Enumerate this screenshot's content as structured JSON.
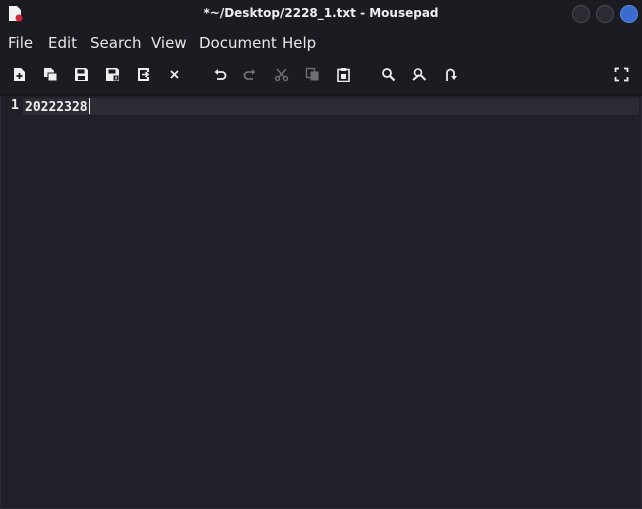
{
  "window": {
    "title": "*~/Desktop/2228_1.txt - Mousepad",
    "app_icon": "mousepad-app-icon"
  },
  "menubar": {
    "items": [
      "File",
      "Edit",
      "Search",
      "View",
      "Document",
      "Help"
    ]
  },
  "toolbar": {
    "buttons": [
      {
        "icon": "new-document-icon",
        "enabled": true
      },
      {
        "icon": "new-window-icon",
        "enabled": true
      },
      {
        "icon": "save-icon",
        "enabled": true
      },
      {
        "icon": "save-as-icon",
        "enabled": true
      },
      {
        "icon": "reload-icon",
        "enabled": true
      },
      {
        "icon": "close-tab-icon",
        "enabled": true
      },
      {
        "icon": "undo-icon",
        "enabled": true
      },
      {
        "icon": "redo-icon",
        "enabled": false
      },
      {
        "icon": "cut-icon",
        "enabled": false
      },
      {
        "icon": "copy-icon",
        "enabled": false
      },
      {
        "icon": "paste-icon",
        "enabled": true
      },
      {
        "icon": "find-icon",
        "enabled": true
      },
      {
        "icon": "find-replace-icon",
        "enabled": true
      },
      {
        "icon": "go-to-line-icon",
        "enabled": true
      },
      {
        "icon": "fullscreen-icon",
        "enabled": true
      }
    ]
  },
  "editor": {
    "lines": [
      {
        "number": "1",
        "text": "20222328"
      }
    ]
  },
  "colors": {
    "background": "#202128",
    "chrome": "#1b1c21",
    "current_line": "#2b2c33",
    "close_button": "#3a6ccf",
    "icon_enabled": "#eeeeee",
    "icon_disabled": "#6e6f76"
  }
}
